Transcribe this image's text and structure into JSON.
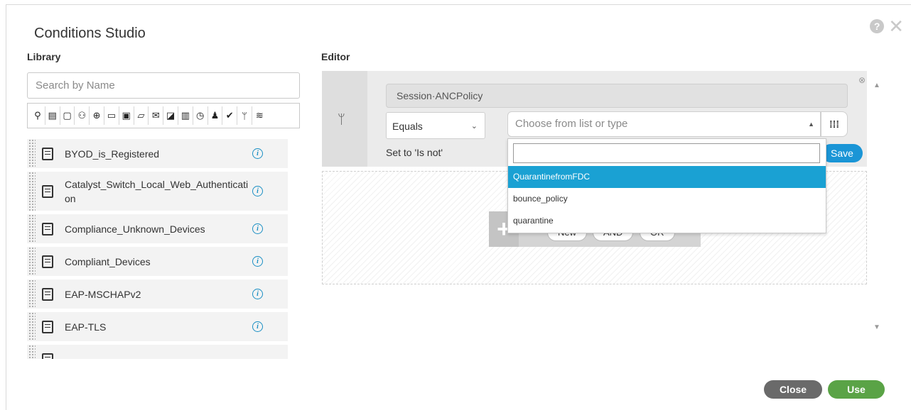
{
  "dialog": {
    "title": "Conditions Studio"
  },
  "library": {
    "label": "Library",
    "search_placeholder": "Search by Name",
    "filter_icons": [
      "location-icon",
      "device-report-icon",
      "square-icon",
      "group-icon",
      "globe-icon",
      "desktop-icon",
      "monitor-icon",
      "chat-icon",
      "mail-icon",
      "file-edit-icon",
      "document-icon",
      "clock-icon",
      "user-icon",
      "check-circle-icon",
      "tree-icon",
      "wifi-icon"
    ],
    "items": [
      {
        "name": "BYOD_is_Registered"
      },
      {
        "name": "Catalyst_Switch_Local_Web_Authentication"
      },
      {
        "name": "Compliance_Unknown_Devices"
      },
      {
        "name": "Compliant_Devices"
      },
      {
        "name": "EAP-MSCHAPv2"
      },
      {
        "name": "EAP-TLS"
      },
      {
        "name": ""
      }
    ]
  },
  "editor": {
    "label": "Editor",
    "attribute": "Session·ANCPolicy",
    "operator": "Equals",
    "value_placeholder": "Choose from list or type",
    "set_to": "Set to 'Is not'",
    "save_label": "Save",
    "dropdown": {
      "search_value": "",
      "options": [
        "QuarantinefromFDC",
        "bounce_policy",
        "quarantine"
      ],
      "highlighted": "QuarantinefromFDC"
    },
    "add_block": {
      "plus": "+",
      "new": "New",
      "and": "AND",
      "or": "OR"
    }
  },
  "footer": {
    "close_label": "Close",
    "use_label": "Use"
  },
  "colors": {
    "accent": "#1a95d6",
    "highlight": "#1aa1d3",
    "use": "#5aa346",
    "close": "#6a6a6a"
  }
}
